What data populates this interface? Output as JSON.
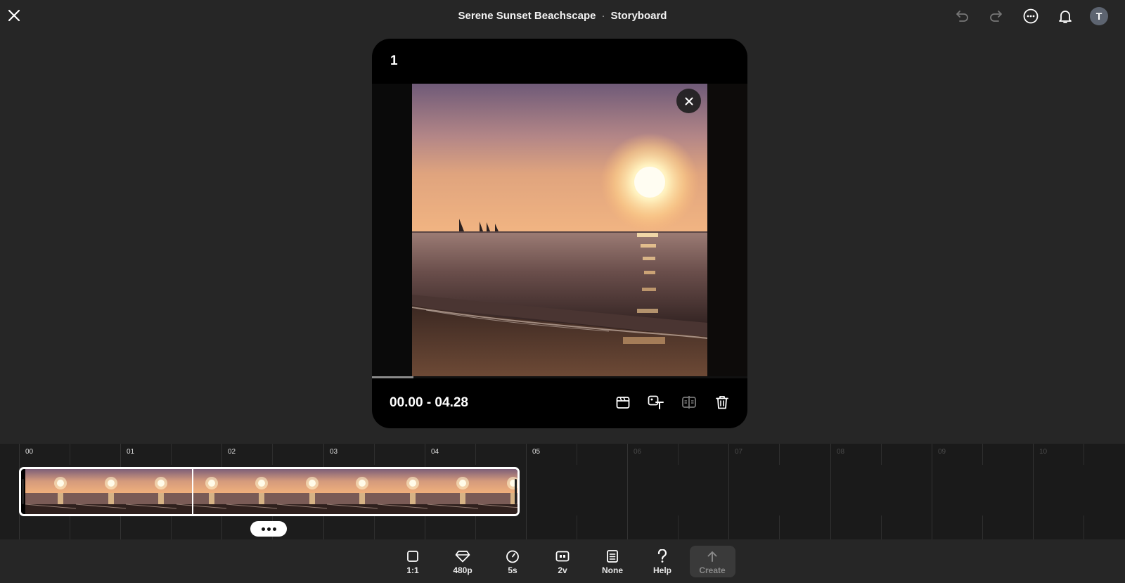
{
  "header": {
    "project_title": "Serene Sunset Beachscape",
    "separator": "·",
    "view_title": "Storyboard",
    "avatar_initial": "T"
  },
  "scene_card": {
    "number": "1",
    "time_range": "00.00 - 04.28",
    "playback_progress": 0.11
  },
  "timeline": {
    "ticks": [
      "00",
      "01",
      "02",
      "03",
      "04",
      "05",
      "06",
      "07",
      "08",
      "09",
      "10"
    ],
    "active_ticks": 6,
    "clip_thumbnails": 10
  },
  "toolbar": {
    "items": [
      {
        "label": "1:1",
        "icon": "square-aspect-icon"
      },
      {
        "label": "480p",
        "icon": "diamond-quality-icon"
      },
      {
        "label": "5s",
        "icon": "timer-icon"
      },
      {
        "label": "2v",
        "icon": "variations-icon"
      },
      {
        "label": "None",
        "icon": "style-preset-icon"
      },
      {
        "label": "Help",
        "icon": "question-icon"
      }
    ],
    "create_label": "Create"
  },
  "colors": {
    "background": "#262626",
    "timeline_bg": "#1c1c1c",
    "card_bg": "#000000"
  }
}
